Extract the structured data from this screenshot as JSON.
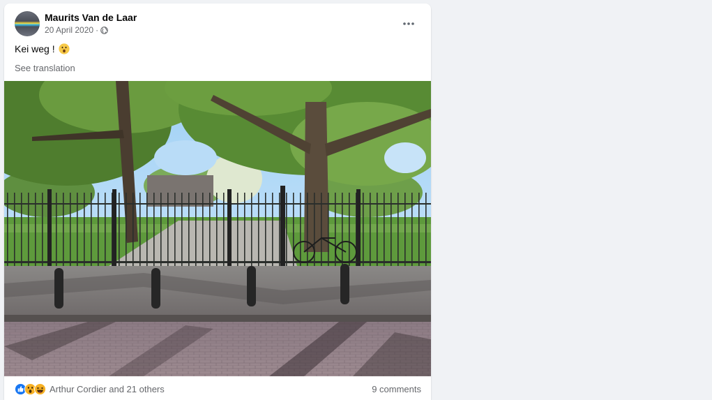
{
  "post": {
    "author": "Maurits Van de Laar",
    "date": "20 April 2020",
    "separator": "·",
    "privacy_icon": "globe-icon",
    "more_icon": "more-dots-icon",
    "text": "Kei weg !",
    "text_emoji": "astonished-face-emoji",
    "see_translation": "See translation",
    "reactions": {
      "icons": [
        "like-reaction-icon",
        "wow-reaction-icon",
        "haha-reaction-icon"
      ],
      "summary": "Arthur Cordier and 21 others"
    },
    "comments": "9 comments"
  },
  "colors": {
    "page_bg": "#f0f2f5",
    "card_bg": "#ffffff",
    "secondary_text": "#65676b",
    "like_blue": "#1877f2",
    "reaction_yellow": "#f7b125"
  }
}
